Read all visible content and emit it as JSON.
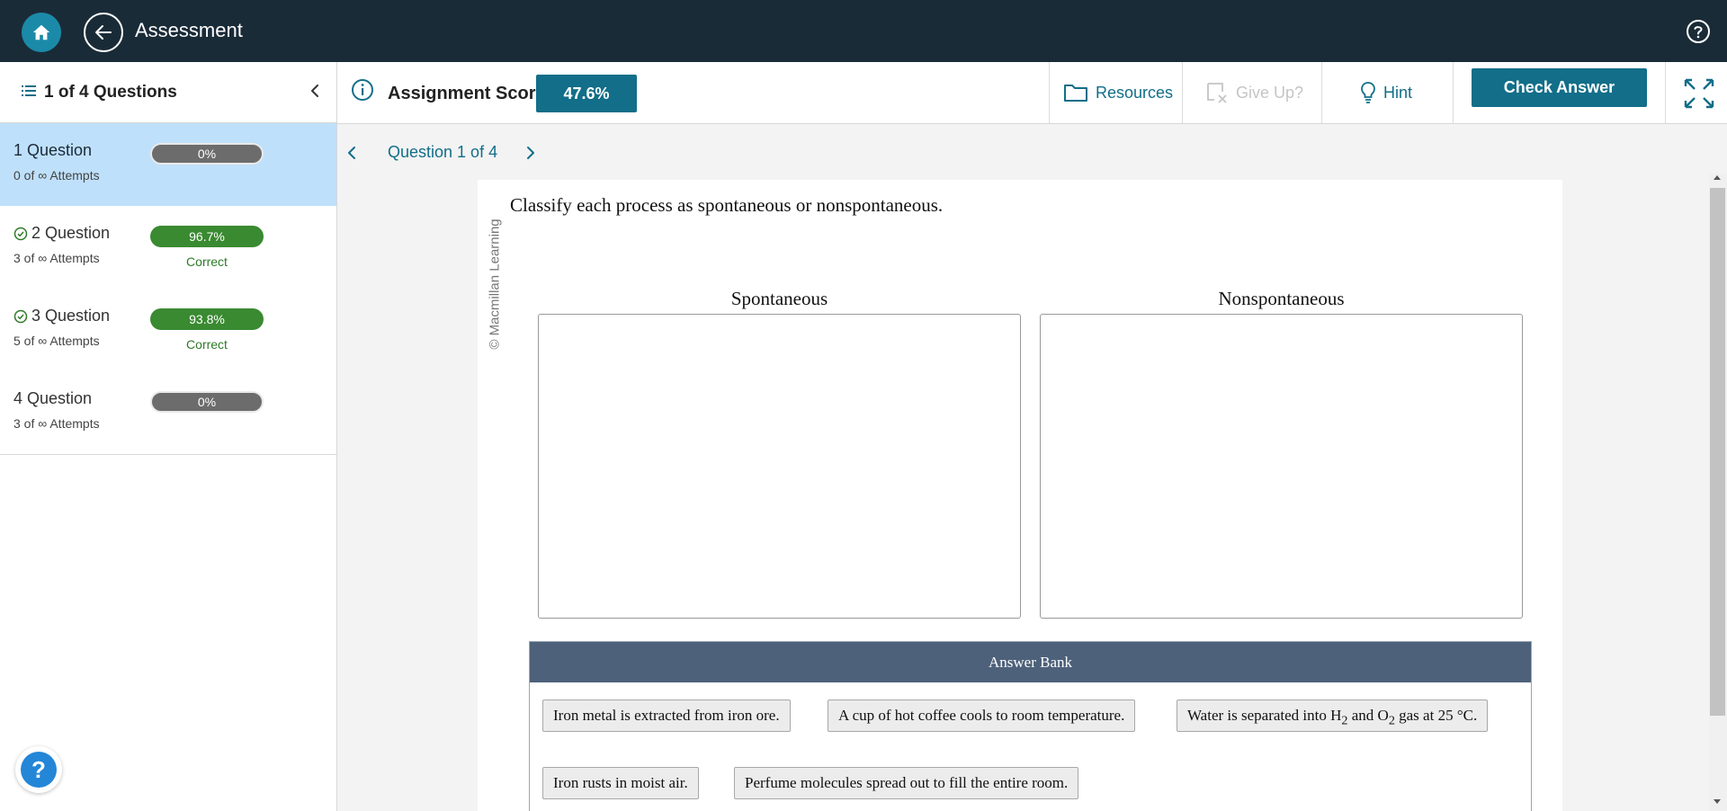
{
  "header": {
    "title": "Assessment"
  },
  "sidebar": {
    "title": "1 of 4 Questions",
    "questions": [
      {
        "name": "1 Question",
        "attempts": "0 of ∞ Attempts",
        "score": "0%",
        "status": ""
      },
      {
        "name": "2 Question",
        "attempts": "3 of ∞ Attempts",
        "score": "96.7%",
        "status": "Correct"
      },
      {
        "name": "3 Question",
        "attempts": "5 of ∞ Attempts",
        "score": "93.8%",
        "status": "Correct"
      },
      {
        "name": "4 Question",
        "attempts": "3 of ∞ Attempts",
        "score": "0%",
        "status": ""
      }
    ],
    "help_symbol": "?"
  },
  "toolbar": {
    "score_label": "Assignment Score:",
    "score_value": "47.6%",
    "resources_label": "Resources",
    "giveup_label": "Give Up?",
    "hint_label": "Hint",
    "check_label": "Check Answer"
  },
  "nav": {
    "question_label": "Question 1 of 4"
  },
  "question": {
    "watermark": "© Macmillan Learning",
    "prompt": "Classify each process as spontaneous or nonspontaneous.",
    "columns": [
      "Spontaneous",
      "Nonspontaneous"
    ],
    "bank_title": "Answer Bank",
    "answers": [
      "Iron metal is extracted from iron ore.",
      "A cup of hot coffee cools to room temperature.",
      "Water is separated into H2 and O2 gas at 25 °C.",
      "Iron rusts in moist air.",
      "Perfume molecules spread out to fill the entire room."
    ],
    "answer3_parts": {
      "pre": "Water is separated into H",
      "sub1": "2",
      "mid": " and O",
      "sub2": "2",
      "post": " gas at 25 °C."
    }
  },
  "colors": {
    "topbar": "#1a2b38",
    "accent": "#126e89",
    "active_item": "#bfe0fb",
    "correct_green": "#3a8a31",
    "bank_header": "#4d617a"
  }
}
